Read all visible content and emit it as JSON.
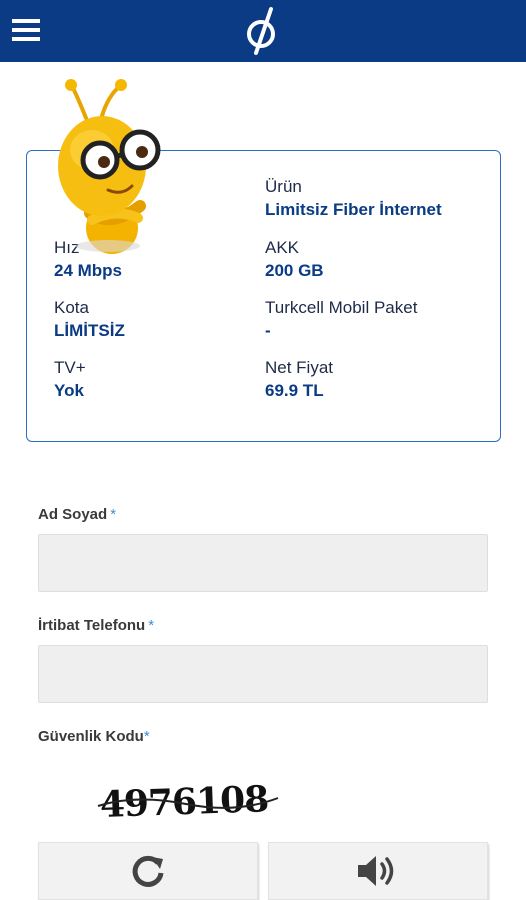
{
  "header": {
    "menu_icon": "hamburger-icon",
    "logo_icon": "turkcell-logo-icon",
    "brand_color": "#0a3b84"
  },
  "package": {
    "mascot": "mascot-illustration",
    "product_label": "Ürün",
    "product_value": "Limitsiz Fiber İnternet",
    "speed_label": "Hız",
    "speed_value": "24 Mbps",
    "akk_label": "AKK",
    "akk_value": "200 GB",
    "quota_label": "Kota",
    "quota_value": "LİMİTSİZ",
    "mobile_label": "Turkcell Mobil Paket",
    "mobile_value": "-",
    "tv_label": "TV+",
    "tv_value": "Yok",
    "price_label": "Net Fiyat",
    "price_value": "69.9 TL",
    "accent_color": "#2c6fc0"
  },
  "form": {
    "name_label": "Ad Soyad",
    "name_value": "",
    "phone_label": "İrtibat Telefonu",
    "phone_value": "",
    "security_label": "Güvenlik Kodu",
    "required_mark": "*",
    "captcha_text": "4976108",
    "refresh_icon": "refresh-icon",
    "audio_icon": "speaker-icon"
  }
}
